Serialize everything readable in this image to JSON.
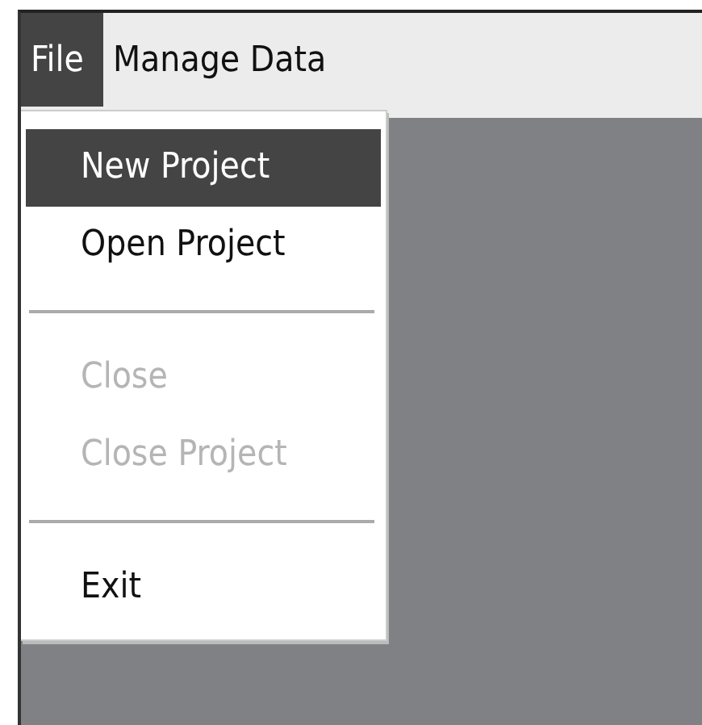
{
  "menubar": [
    {
      "label": "File",
      "selected": true
    },
    {
      "label": "Manage Data",
      "selected": false
    }
  ],
  "file_menu": [
    {
      "kind": "item",
      "label": "New Project",
      "selected": true,
      "disabled": false
    },
    {
      "kind": "item",
      "label": "Open Project",
      "selected": false,
      "disabled": false
    },
    {
      "kind": "separator"
    },
    {
      "kind": "item",
      "label": "Close",
      "selected": false,
      "disabled": true
    },
    {
      "kind": "item",
      "label": "Close Project",
      "selected": false,
      "disabled": true
    },
    {
      "kind": "separator"
    },
    {
      "kind": "item",
      "label": "Exit",
      "selected": false,
      "disabled": false
    }
  ]
}
